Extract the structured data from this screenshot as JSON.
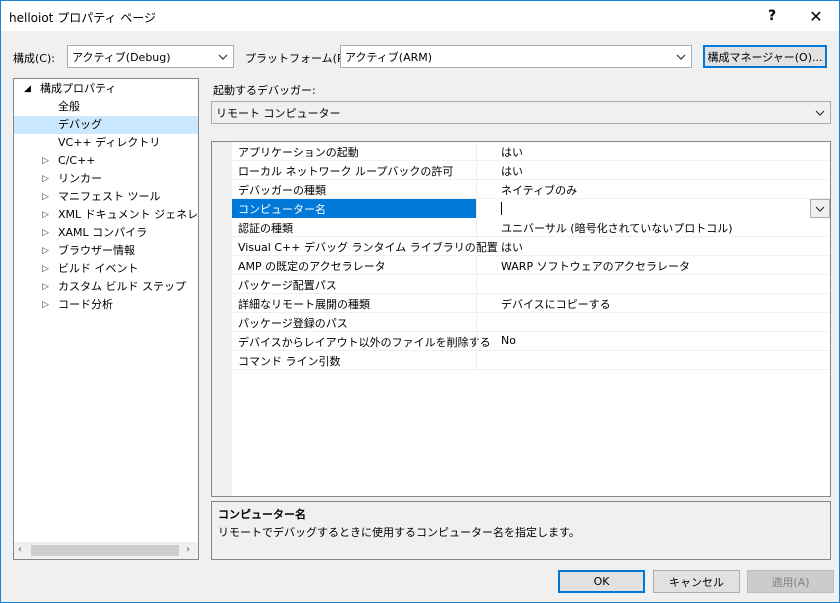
{
  "window": {
    "title": "helloiot プロパティ ページ",
    "help": "?",
    "close": "✕"
  },
  "toolbar": {
    "config_label": "構成(C):",
    "config_value": "アクティブ(Debug)",
    "platform_label": "プラットフォーム(P):",
    "platform_value": "アクティブ(ARM)",
    "config_manager_label": "構成マネージャー(O)..."
  },
  "tree": {
    "root": "構成プロパティ",
    "items": [
      {
        "label": "全般",
        "expandable": false
      },
      {
        "label": "デバッグ",
        "expandable": false,
        "selected": true
      },
      {
        "label": "VC++ ディレクトリ",
        "expandable": false
      },
      {
        "label": "C/C++",
        "expandable": true
      },
      {
        "label": "リンカー",
        "expandable": true
      },
      {
        "label": "マニフェスト ツール",
        "expandable": true
      },
      {
        "label": "XML ドキュメント ジェネレーター",
        "expandable": true
      },
      {
        "label": "XAML コンパイラ",
        "expandable": true
      },
      {
        "label": "ブラウザー情報",
        "expandable": true
      },
      {
        "label": "ビルド イベント",
        "expandable": true
      },
      {
        "label": "カスタム ビルド ステップ",
        "expandable": true
      },
      {
        "label": "コード分析",
        "expandable": true
      }
    ]
  },
  "debugger": {
    "label": "起動するデバッガー:",
    "value": "リモート コンピューター"
  },
  "grid": {
    "rows": [
      {
        "name": "アプリケーションの起動",
        "value": "はい"
      },
      {
        "name": "ローカル ネットワーク ループバックの許可",
        "value": "はい"
      },
      {
        "name": "デバッガーの種類",
        "value": "ネイティブのみ"
      },
      {
        "name": "コンピューター名",
        "value": "",
        "selected": true
      },
      {
        "name": "認証の種類",
        "value": "ユニバーサル (暗号化されていないプロトコル)"
      },
      {
        "name": "Visual C++ デバッグ ランタイム ライブラリの配置",
        "value": "はい"
      },
      {
        "name": "AMP の既定のアクセラレータ",
        "value": "WARP ソフトウェアのアクセラレータ"
      },
      {
        "name": "パッケージ配置パス",
        "value": ""
      },
      {
        "name": "詳細なリモート展開の種類",
        "value": "デバイスにコピーする"
      },
      {
        "name": "パッケージ登録のパス",
        "value": ""
      },
      {
        "name": "デバイスからレイアウト以外のファイルを削除する",
        "value": "No"
      },
      {
        "name": "コマンド ライン引数",
        "value": ""
      }
    ]
  },
  "description": {
    "title": "コンピューター名",
    "text": "リモートでデバッグするときに使用するコンピューター名を指定します。"
  },
  "buttons": {
    "ok": "OK",
    "cancel": "キャンセル",
    "apply": "適用(A)"
  }
}
